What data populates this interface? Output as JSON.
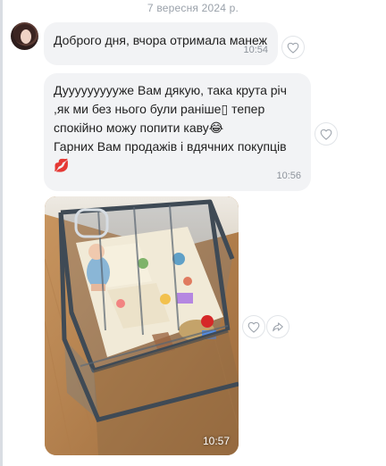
{
  "conversation": {
    "date": "7 вересня 2024 р."
  },
  "messages": [
    {
      "type": "text",
      "text": "Доброго дня, вчора отримала манеж",
      "time": "10:54"
    },
    {
      "type": "text",
      "lines": [
        "Дуууууууууже Вам дякую, така крута річ",
        ",як ми без нього були раніше▯ тепер",
        "спокійно можу попити каву😂",
        "Гарних Вам продажів і вдячних покупців",
        "💋"
      ],
      "time": "10:56"
    },
    {
      "type": "photo",
      "time": "10:57"
    }
  ],
  "icons": {
    "heart": "heart-icon",
    "share": "share-icon"
  },
  "colors": {
    "bubble_bg": "#f2f3f5",
    "time_text": "#8e949c",
    "date_text": "#9aa1aa"
  }
}
